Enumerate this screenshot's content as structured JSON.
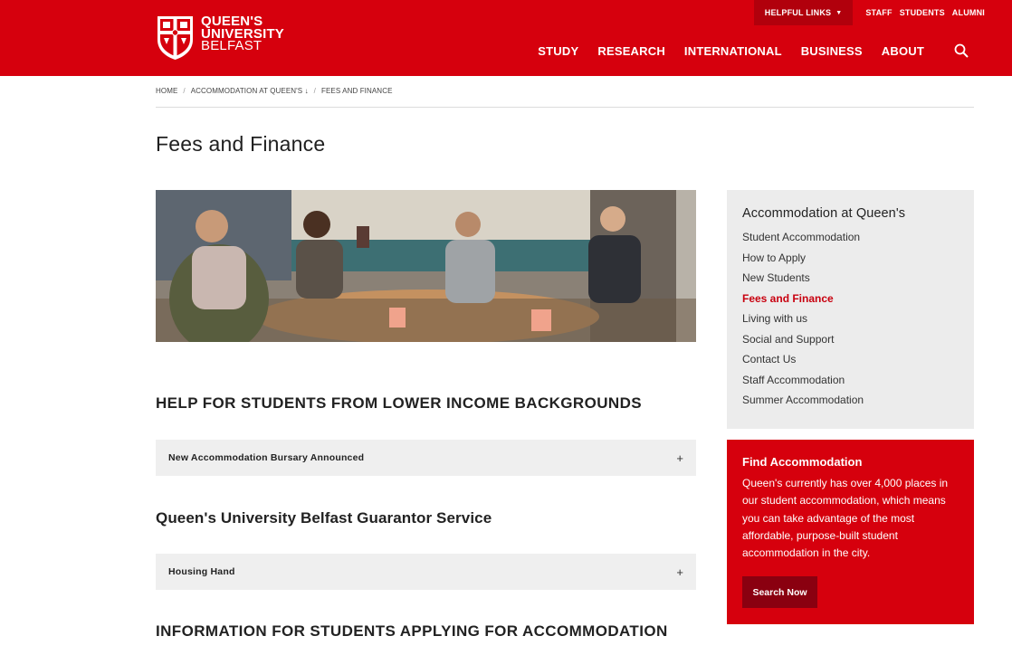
{
  "header": {
    "helpful_links": "HELPFUL LINKS",
    "top_links": [
      "STAFF",
      "STUDENTS",
      "ALUMNI"
    ],
    "logo": {
      "line1": "QUEEN'S",
      "line2": "UNIVERSITY",
      "line3": "BELFAST"
    },
    "nav": [
      "STUDY",
      "RESEARCH",
      "INTERNATIONAL",
      "BUSINESS",
      "ABOUT"
    ],
    "brand_color": "#d6000d"
  },
  "breadcrumb": {
    "home": "HOME",
    "section": "ACCOMMODATION AT QUEEN'S",
    "section_arrow": "↓",
    "current": "FEES AND FINANCE",
    "separator": "/"
  },
  "page": {
    "title": "Fees and Finance"
  },
  "main": {
    "heading1": "HELP FOR STUDENTS FROM LOWER INCOME BACKGROUNDS",
    "accordion1": "New Accommodation Bursary Announced",
    "heading2": "Queen's University Belfast Guarantor Service",
    "accordion2": "Housing Hand",
    "heading3": "INFORMATION FOR STUDENTS APPLYING FOR ACCOMMODATION",
    "expand_symbol": "+"
  },
  "sidebar": {
    "title": "Accommodation at Queen's",
    "items": [
      {
        "label": "Student Accommodation"
      },
      {
        "label": "How to Apply"
      },
      {
        "label": "New Students"
      },
      {
        "label": "Fees and Finance",
        "active": true
      },
      {
        "label": "Living with us"
      },
      {
        "label": "Social and Support"
      },
      {
        "label": "Contact Us"
      },
      {
        "label": "Staff Accommodation"
      },
      {
        "label": "Summer Accommodation"
      }
    ],
    "active_color": "#c8000f"
  },
  "find_box": {
    "title": "Find Accommodation",
    "text": "Queen's currently has over 4,000 places in our student accommodation, which means you can take advantage of the most affordable, purpose-built student accommodation in the city.",
    "button": "Search Now",
    "button_color": "#8a0010"
  },
  "icons": {
    "search": "search-icon",
    "caret": "caret-down-icon",
    "plus": "plus-icon",
    "crest": "university-crest-icon"
  }
}
